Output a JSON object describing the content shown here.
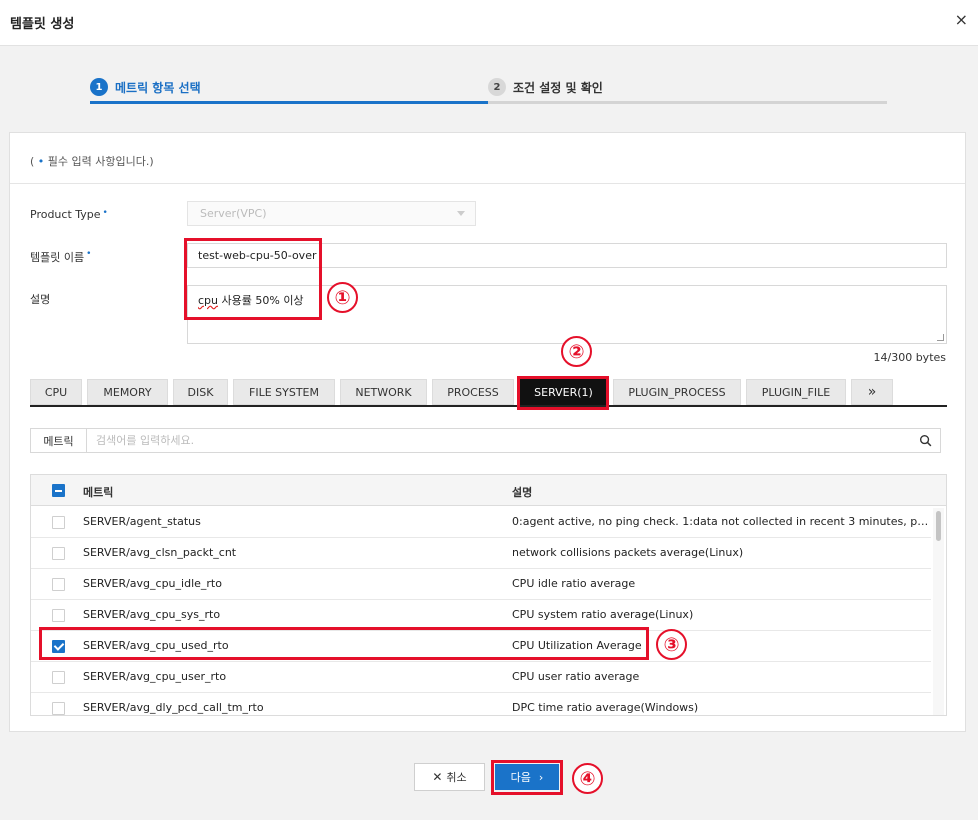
{
  "dialog": {
    "title": "템플릿 생성",
    "close_icon": "×"
  },
  "steps": [
    {
      "num": "1",
      "label": "메트릭 항목 선택"
    },
    {
      "num": "2",
      "label": "조건 설정 및 확인"
    }
  ],
  "form": {
    "required_note_prefix": "( ",
    "required_note_dot": "•",
    "required_note_text": " 필수 입력 사항입니다.)",
    "required_dot": "•",
    "product_type_label": "Product Type",
    "product_type_value": "Server(VPC)",
    "template_name_label": "템플릿 이름",
    "template_name_value": "test-web-cpu-50-over",
    "description_label": "설명",
    "description_spell": "cpu",
    "description_rest": " 사용률 50% 이상",
    "byte_count": "14/300 bytes"
  },
  "tabs": [
    "CPU",
    "MEMORY",
    "DISK",
    "FILE SYSTEM",
    "NETWORK",
    "PROCESS",
    "SERVER(1)",
    "PLUGIN_PROCESS",
    "PLUGIN_FILE",
    "»"
  ],
  "search": {
    "prefix": "메트릭",
    "placeholder": "검색어를 입력하세요."
  },
  "table": {
    "headers": {
      "metric": "메트릭",
      "description": "설명"
    },
    "rows": [
      {
        "metric": "SERVER/agent_status",
        "description": "0:agent active, no ping check. 1:data not collected in recent 3 minutes, pi...",
        "checked": false
      },
      {
        "metric": "SERVER/avg_clsn_packt_cnt",
        "description": "network collisions packets average(Linux)",
        "checked": false
      },
      {
        "metric": "SERVER/avg_cpu_idle_rto",
        "description": "CPU idle ratio average",
        "checked": false
      },
      {
        "metric": "SERVER/avg_cpu_sys_rto",
        "description": "CPU system ratio average(Linux)",
        "checked": false
      },
      {
        "metric": "SERVER/avg_cpu_used_rto",
        "description": "CPU Utilization Average",
        "checked": true
      },
      {
        "metric": "SERVER/avg_cpu_user_rto",
        "description": "CPU user ratio average",
        "checked": false
      },
      {
        "metric": "SERVER/avg_dly_pcd_call_tm_rto",
        "description": "DPC time ratio average(Windows)",
        "checked": false
      }
    ]
  },
  "buttons": {
    "cancel_icon": "✕",
    "cancel": "취소",
    "next": "다음",
    "next_icon": "›"
  },
  "annotations": [
    "①",
    "②",
    "③",
    "④"
  ],
  "colors": {
    "accent": "#1a73c9",
    "highlight": "#e5102a",
    "active_tab": "#111111"
  }
}
